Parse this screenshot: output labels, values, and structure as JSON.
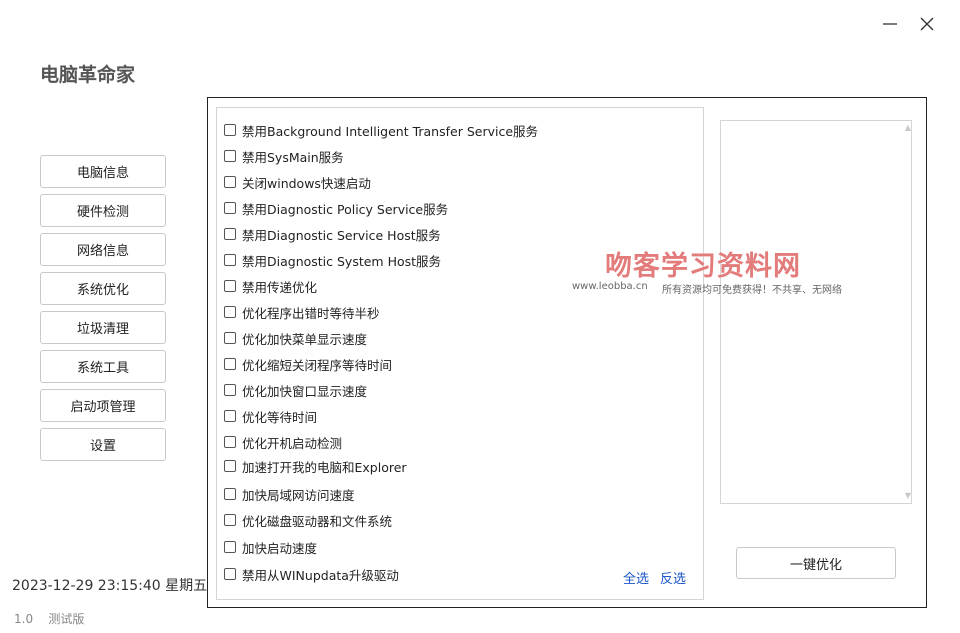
{
  "window": {
    "minimize_icon": "minimize-icon",
    "close_icon": "close-icon"
  },
  "app": {
    "title": "电脑革命家"
  },
  "nav": {
    "items": [
      {
        "label": "电脑信息"
      },
      {
        "label": "硬件检测"
      },
      {
        "label": "网络信息"
      },
      {
        "label": "系统优化"
      },
      {
        "label": "垃圾清理"
      },
      {
        "label": "系统工具"
      },
      {
        "label": "启动项管理"
      },
      {
        "label": "设置"
      }
    ]
  },
  "footer": {
    "datetime": "2023-12-29 23:15:40  星期五",
    "version_number": "1.0",
    "version_label": "测试版"
  },
  "options": [
    {
      "label": "禁用Background Intelligent Transfer Service服务",
      "checked": false
    },
    {
      "label": "禁用SysMain服务",
      "checked": false
    },
    {
      "label": "关闭windows快速启动",
      "checked": false
    },
    {
      "label": "禁用Diagnostic Policy Service服务",
      "checked": false
    },
    {
      "label": "禁用Diagnostic Service Host服务",
      "checked": false
    },
    {
      "label": "禁用Diagnostic System Host服务",
      "checked": false
    },
    {
      "label": "禁用传递优化",
      "checked": false
    },
    {
      "label": "优化程序出错时等待半秒",
      "checked": false
    },
    {
      "label": "优化加快菜单显示速度",
      "checked": false
    },
    {
      "label": "优化缩短关闭程序等待时间",
      "checked": false
    },
    {
      "label": "优化加快窗口显示速度",
      "checked": false
    },
    {
      "label": "优化等待时间",
      "checked": false
    },
    {
      "label": "优化开机启动检测",
      "checked": false
    },
    {
      "label": "加速打开我的电脑和Explorer",
      "checked": false
    },
    {
      "label": "加快局域网访问速度",
      "checked": false
    },
    {
      "label": "优化磁盘驱动器和文件系统",
      "checked": false
    },
    {
      "label": "加快启动速度",
      "checked": false
    },
    {
      "label": "禁用从WINupdata升级驱动",
      "checked": false
    }
  ],
  "selection": {
    "select_all": "全选",
    "invert": "反选"
  },
  "action": {
    "optimize_label": "一键优化"
  },
  "watermark": {
    "title": "吻客学习资料网",
    "url": "www.leobba.cn",
    "slogan": "所有资源均可免费获得！不共享、无网络"
  }
}
